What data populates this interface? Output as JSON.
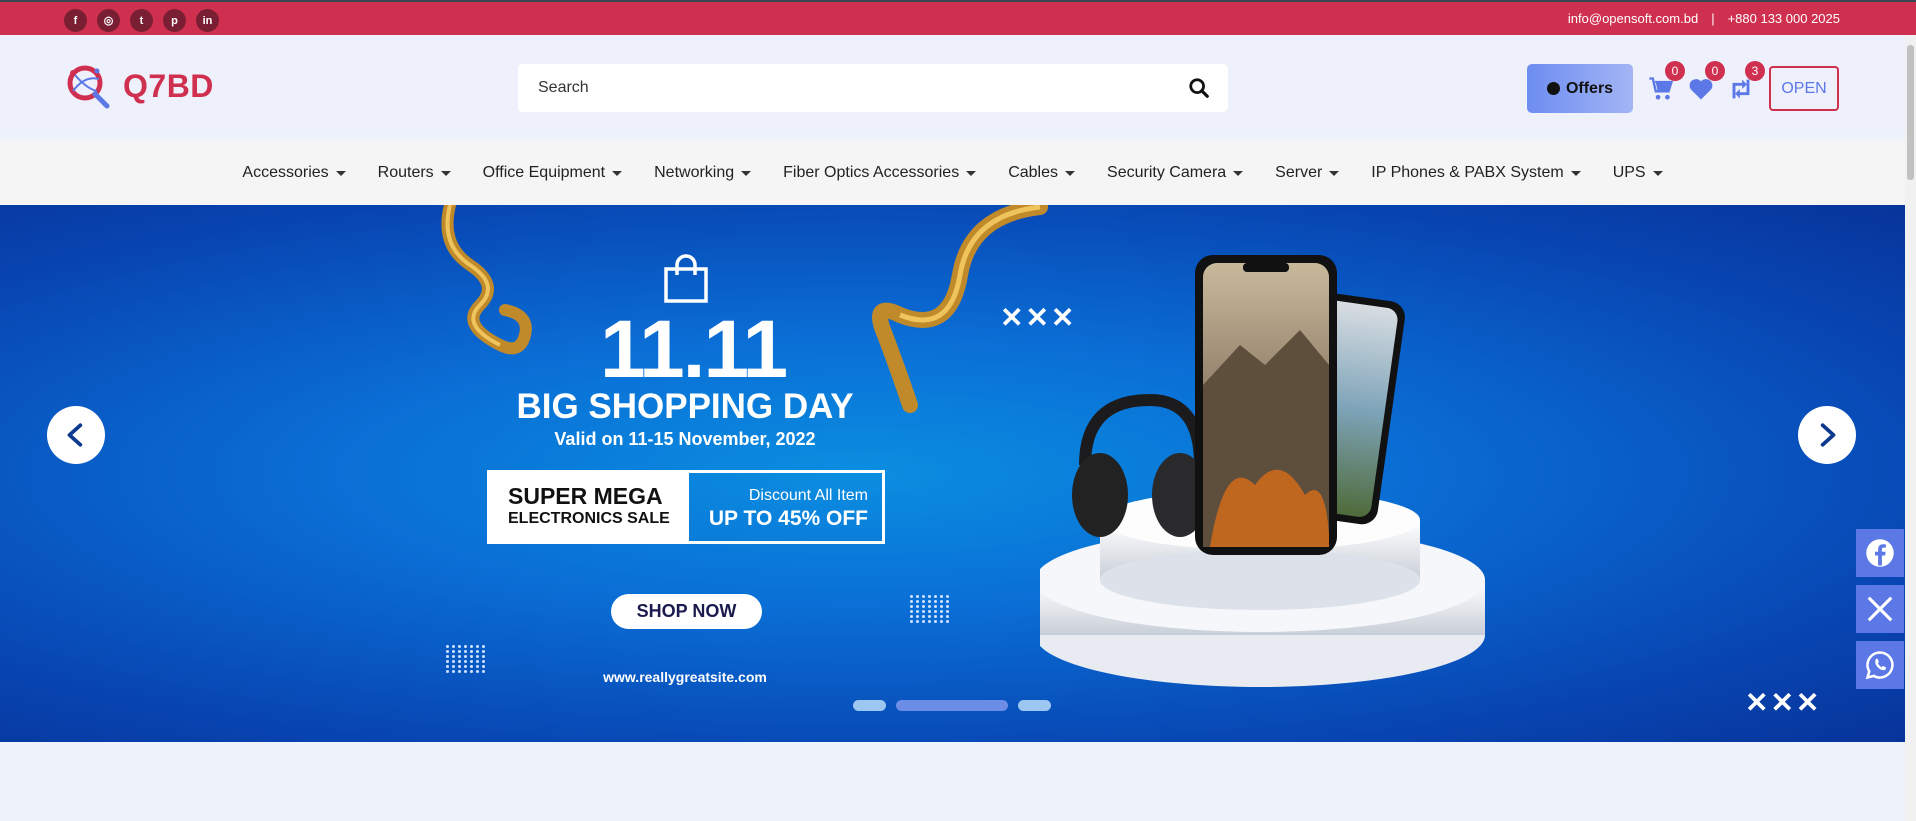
{
  "topbar": {
    "socials": [
      {
        "icon": "facebook-icon",
        "glyph": "f"
      },
      {
        "icon": "instagram-icon",
        "glyph": "◎"
      },
      {
        "icon": "twitter-icon",
        "glyph": "t"
      },
      {
        "icon": "pinterest-icon",
        "glyph": "p"
      },
      {
        "icon": "linkedin-icon",
        "glyph": "in"
      }
    ],
    "email": "info@opensoft.com.bd",
    "separator": "|",
    "phone": "+880 133 000 2025"
  },
  "header": {
    "logo_text": "Q7BD",
    "search_placeholder": "Search",
    "offers_label": "Offers",
    "cart_count": "0",
    "wishlist_count": "0",
    "compare_count": "3",
    "open_label": "OPEN"
  },
  "nav": {
    "items": [
      {
        "label": "Accessories"
      },
      {
        "label": "Routers"
      },
      {
        "label": "Office Equipment"
      },
      {
        "label": "Networking"
      },
      {
        "label": "Fiber Optics Accessories"
      },
      {
        "label": "Cables"
      },
      {
        "label": "Security Camera"
      },
      {
        "label": "Server"
      },
      {
        "label": "IP Phones & PABX System"
      },
      {
        "label": "UPS"
      }
    ]
  },
  "hero": {
    "big_date": "11.11",
    "title": "BIG SHOPPING DAY",
    "valid": "Valid on 11-15 November, 2022",
    "promo_left_line1": "SUPER MEGA",
    "promo_left_line2": "ELECTRONICS SALE",
    "promo_right_line1": "Discount All Item",
    "promo_right_line2": "UP TO 45% OFF",
    "shop_button": "SHOP NOW",
    "site_url": "www.reallygreatsite.com",
    "decor_marks": "✕✕✕",
    "active_slide": 2,
    "slide_count": 3
  },
  "colors": {
    "brand_red": "#d0304f",
    "accent_blue": "#5b78e6"
  },
  "share_buttons": [
    {
      "icon": "facebook-share-icon"
    },
    {
      "icon": "x-share-icon"
    },
    {
      "icon": "whatsapp-share-icon"
    }
  ]
}
